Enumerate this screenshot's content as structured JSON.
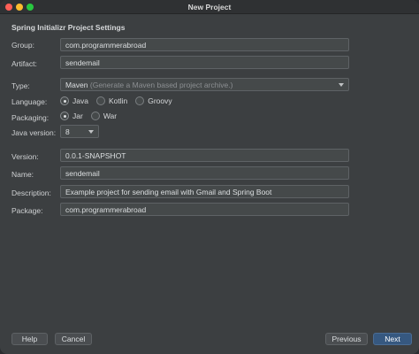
{
  "window": {
    "title": "New Project"
  },
  "section_title": "Spring Initializr Project Settings",
  "fields": {
    "group": {
      "label": "Group:",
      "value": "com.programmerabroad"
    },
    "artifact": {
      "label": "Artifact:",
      "value": "sendemail"
    },
    "type": {
      "label": "Type:",
      "value": "Maven",
      "hint": "(Generate a Maven based project archive.)"
    },
    "language": {
      "label": "Language:",
      "options": [
        "Java",
        "Kotlin",
        "Groovy"
      ],
      "selected": "Java"
    },
    "packaging": {
      "label": "Packaging:",
      "options": [
        "Jar",
        "War"
      ],
      "selected": "Jar"
    },
    "java_version": {
      "label": "Java version:",
      "value": "8"
    },
    "version": {
      "label": "Version:",
      "value": "0.0.1-SNAPSHOT"
    },
    "name": {
      "label": "Name:",
      "value": "sendemail"
    },
    "description": {
      "label": "Description:",
      "value": "Example project for sending email with Gmail and Spring Boot"
    },
    "package": {
      "label": "Package:",
      "value": "com.programmerabroad"
    }
  },
  "buttons": {
    "help": "Help",
    "cancel": "Cancel",
    "previous": "Previous",
    "next": "Next"
  },
  "colors": {
    "background": "#3c3f41",
    "field": "#45494a",
    "primary_button": "#365880"
  }
}
